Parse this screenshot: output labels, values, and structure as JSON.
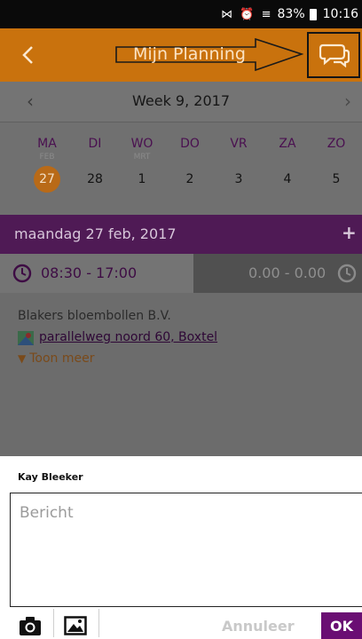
{
  "status_bar": {
    "battery": "83%",
    "time": "10:16",
    "icons": "⋈ ⏰ ≡"
  },
  "header": {
    "title": "Mijn Planning",
    "back_icon": "back-chevron-icon",
    "chat_icon": "chat-bubbles-icon"
  },
  "week": {
    "label": "Week 9, 2017"
  },
  "days": [
    {
      "name": "MA",
      "month": "FEB",
      "num": "27"
    },
    {
      "name": "DI",
      "month": "",
      "num": "28"
    },
    {
      "name": "WO",
      "month": "MRT",
      "num": "1"
    },
    {
      "name": "DO",
      "month": "",
      "num": "2"
    },
    {
      "name": "VR",
      "month": "",
      "num": "3"
    },
    {
      "name": "ZA",
      "month": "",
      "num": "4"
    },
    {
      "name": "ZO",
      "month": "",
      "num": "5"
    }
  ],
  "selected_day": "27",
  "date_bar": {
    "label": "maandag 27 feb, 2017",
    "add": "+"
  },
  "shift": {
    "planned": "08:30 - 17:00",
    "actual": "0.00 - 0.00"
  },
  "detail": {
    "company": "Blakers bloembollen B.V.",
    "address": "parallelweg noord 60, Boxtel",
    "more": "Toon meer"
  },
  "dialog": {
    "sender": "Kay Bleeker",
    "placeholder": "Bericht",
    "cancel": "Annuleer",
    "ok": "OK"
  },
  "colors": {
    "accent_orange": "#c9720d",
    "accent_purple": "#6a0e73",
    "overlay": "#6a6a6a"
  }
}
